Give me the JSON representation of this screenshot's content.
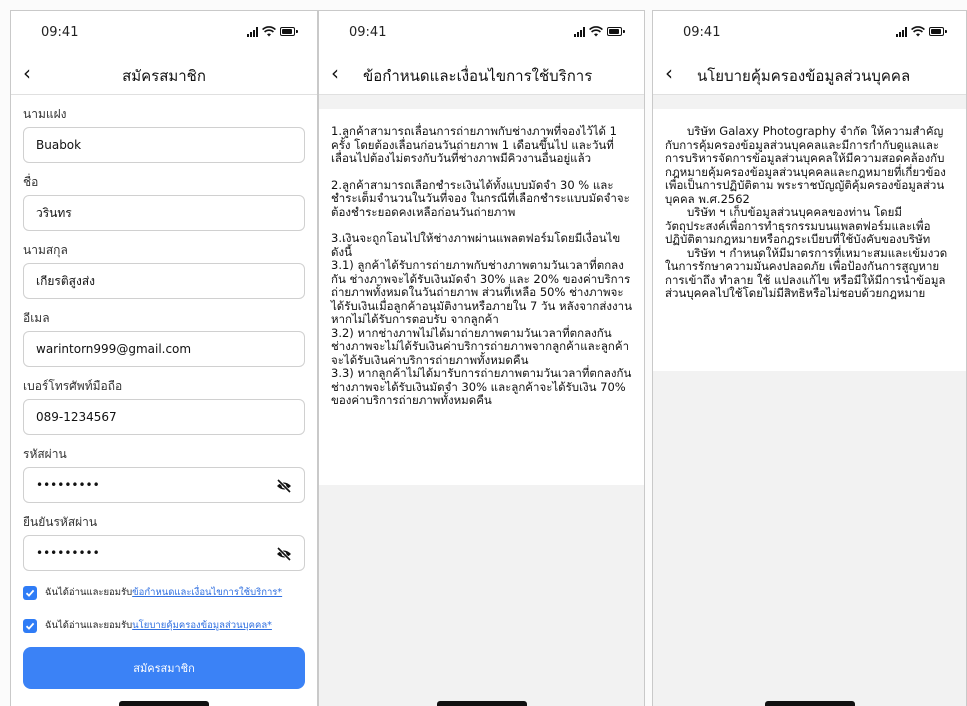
{
  "status_bar": {
    "time": "09:41"
  },
  "signup": {
    "title": "สมัครสมาชิก",
    "fields": [
      {
        "label": "นามแฝง",
        "value": "Buabok"
      },
      {
        "label": "ชื่อ",
        "value": "วรินทร"
      },
      {
        "label": "นามสกุล",
        "value": "เกียรติสูงส่ง"
      },
      {
        "label": "อีเมล",
        "value": "warintorn999@gmail.com"
      },
      {
        "label": "เบอร์โทรศัพท์มือถือ",
        "value": "089-1234567"
      },
      {
        "label": "รหัสผ่าน",
        "value": "•••••••••"
      },
      {
        "label": "ยืนยันรหัสผ่าน",
        "value": "•••••••••"
      }
    ],
    "consents": [
      {
        "prefix": "ฉันได้อ่านและยอมรับ",
        "link": "ข้อกำหนดและเงื่อนไขการใช้บริการ*",
        "checked": true
      },
      {
        "prefix": "ฉันได้อ่านและยอมรับ",
        "link": "นโยบายคุ้มครองข้อมูลส่วนบุคคล*",
        "checked": true
      }
    ],
    "submit_label": "สมัครสมาชิก"
  },
  "terms": {
    "title": "ข้อกำหนดและเงื่อนไขการใช้บริการ",
    "para1": "1.ลูกค้าสามารถเลื่อนการถ่ายภาพกับช่างภาพที่จองไว้ได้ 1 ครั้ง โดยต้องเลื่อนก่อนวันถ่ายภาพ 1 เดือนขึ้นไป และวันที่เลื่อนไปต้องไม่ตรงกับวันที่ช่างภาพมีคิวงานอื่นอยู่แล้ว",
    "para2": "2.ลูกค้าสามารถเลือกชำระเงินได้ทั้งแบบมัดจำ 30 % และชำระเต็มจำนวนในวันที่จอง ในกรณีที่เลือกชำระแบบมัดจำจะต้องชำระยอดคงเหลือก่อนวันถ่ายภาพ",
    "para3_intro": "3.เงินจะถูกโอนไปให้ช่างภาพผ่านแพลตฟอร์มโดยมีเงื่อนไขดังนี้",
    "para3_1": "3.1) ลูกค้าได้รับการถ่ายภาพกับช่างภาพตามวันเวลาที่ตกลงกัน ช่างภาพจะได้รับเงินมัดจำ 30% และ 20% ของค่าบริการถ่ายภาพทั้งหมดในวันถ่ายภาพ ส่วนที่เหลือ 50% ช่างภาพจะได้รับเงินเมื่อลูกค้าอนุมัติงานหรือภายใน 7 วัน หลังจากส่งงานหากไม่ได้รับการตอบรับ จากลูกค้า",
    "para3_2": "3.2) หากช่างภาพไม่ได้มาถ่ายภาพตามวันเวลาที่ตกลงกัน ช่างภาพจะไม่ได้รับเงินค่าบริการถ่ายภาพจากลูกค้าและลูกค้าจะได้รับเงินค่าบริการถ่ายภาพทั้งหมดคืน",
    "para3_3": "3.3) หากลูกค้าไม่ได้มารับการถ่ายภาพตามวันเวลาที่ตกลงกัน ช่างภาพจะได้รับเงินมัดจำ 30% และลูกค้าจะได้รับเงิน 70% ของค่าบริการถ่ายภาพทั้งหมดคืน"
  },
  "privacy": {
    "title": "นโยบายคุ้มครองข้อมูลส่วนบุคคล",
    "para1": "บริษัท Galaxy Photography จำกัด ให้ความสำคัญกับการคุ้มครองข้อมูลส่วนบุคคลและมีการกำกับดูแลและการบริหารจัดการข้อมูลส่วนบุคคลให้มีความสอดคล้องกับกฎหมายคุ้มครองข้อมูลส่วนบุคคลและกฎหมายที่เกี่ยวข้อง เพื่อเป็นการปฏิบัติตาม พระราชบัญญัติคุ้มครองข้อมูลส่วนบุคคล พ.ศ.2562",
    "para2": "บริษัท ฯ เก็บข้อมูลส่วนบุคคลของท่าน โดยมีวัตถุประสงค์เพื่อการทำธุรกรรมบนแพลตฟอร์มและเพื่อปฏิบัติตามกฎหมายหรือกฎระเบียบที่ใช้บังคับของบริษัท",
    "para3": "บริษัท ฯ กำหนดให้มีมาตรการที่เหมาะสมและเข้มงวดในการรักษาความมั่นคงปลอดภัย เพื่อป้องกันการสูญหาย การเข้าถึง ทำลาย ใช้ แปลงแก้ไข หรือมีให้มีการนำข้อมูลส่วนบุคคลไปใช้โดยไม่มีสิทธิหรือไม่ชอบด้วยกฎหมาย"
  }
}
